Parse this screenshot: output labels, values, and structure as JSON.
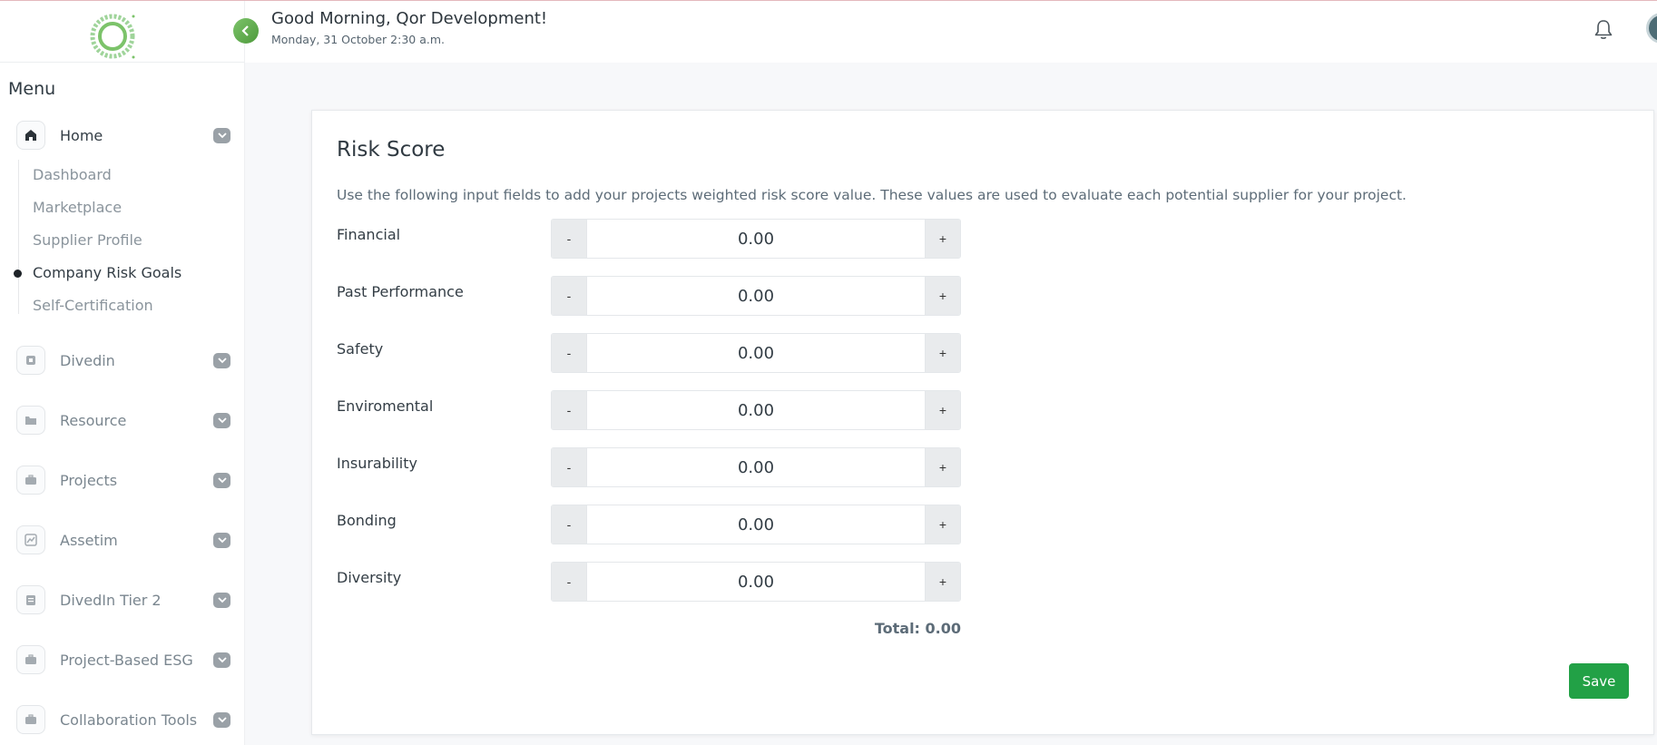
{
  "header": {
    "greeting": "Good Morning, Qor Development!",
    "date": "Monday, 31 October 2:30 a.m."
  },
  "sidebar": {
    "menu_title": "Menu",
    "items": [
      {
        "label": "Home",
        "icon": "home-icon"
      },
      {
        "label": "Divedin",
        "icon": "building-icon"
      },
      {
        "label": "Resource",
        "icon": "folder-icon"
      },
      {
        "label": "Projects",
        "icon": "briefcase-icon"
      },
      {
        "label": "Assetim",
        "icon": "chart-icon"
      },
      {
        "label": "DivedIn Tier 2",
        "icon": "clipboard-icon"
      },
      {
        "label": "Project-Based ESG",
        "icon": "briefcase-icon"
      },
      {
        "label": "Collaboration Tools",
        "icon": "briefcase-icon"
      }
    ],
    "home_submenu": [
      "Dashboard",
      "Marketplace",
      "Supplier Profile",
      "Company Risk Goals",
      "Self-Certification"
    ],
    "current_subitem": "Company Risk Goals"
  },
  "risk": {
    "title": "Risk Score",
    "description": "Use the following input fields to add your projects weighted risk score value. These values are used to evaluate each potential supplier for your project.",
    "fields": [
      {
        "label": "Financial",
        "value": "0.00"
      },
      {
        "label": "Past Performance",
        "value": "0.00"
      },
      {
        "label": "Safety",
        "value": "0.00"
      },
      {
        "label": "Enviromental",
        "value": "0.00"
      },
      {
        "label": "Insurability",
        "value": "0.00"
      },
      {
        "label": "Bonding",
        "value": "0.00"
      },
      {
        "label": "Diversity",
        "value": "0.00"
      }
    ],
    "minus_label": "-",
    "plus_label": "+",
    "total": "Total: 0.00",
    "save_label": "Save"
  },
  "colors": {
    "accent_green": "#22a146",
    "sidebar_bg": "#ffffff"
  }
}
